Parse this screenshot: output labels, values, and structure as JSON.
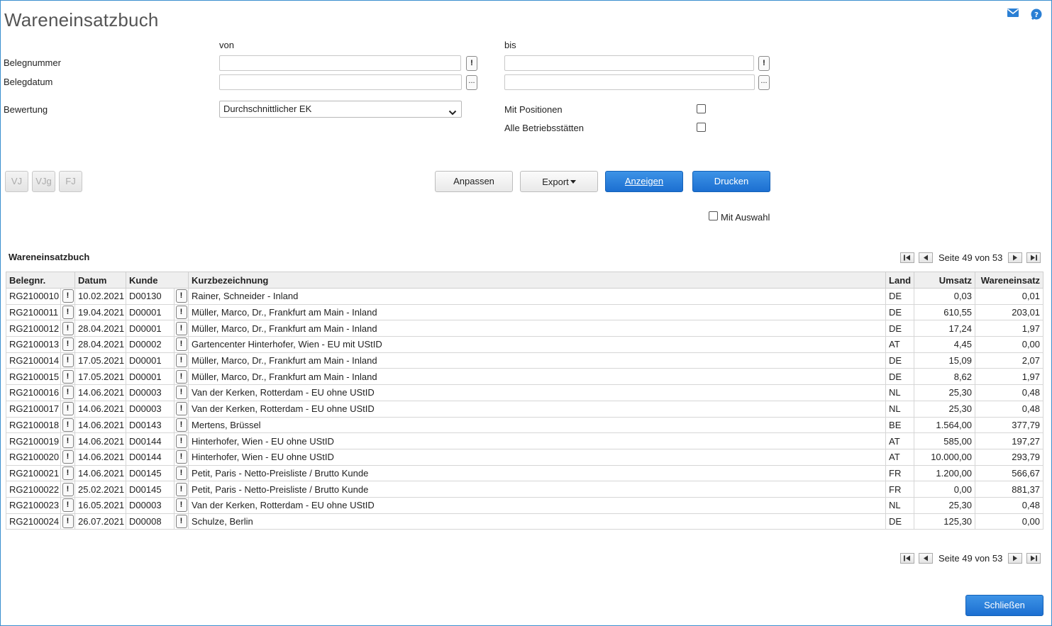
{
  "window": {
    "title": "Wareneinsatzbuch"
  },
  "icons": {
    "mail": "mail-icon",
    "help": "help-icon"
  },
  "filters": {
    "von_label": "von",
    "bis_label": "bis",
    "belegnummer_label": "Belegnummer",
    "belegdatum_label": "Belegdatum",
    "bewertung_label": "Bewertung",
    "belegnummer_von": "",
    "belegnummer_bis": "",
    "belegdatum_von": "",
    "belegdatum_bis": "",
    "bewertung_value": "Durchschnittlicher EK",
    "mit_positionen_label": "Mit Positionen",
    "mit_positionen_checked": false,
    "alle_betriebsstaetten_label": "Alle Betriebsstätten",
    "alle_betriebsstaetten_checked": false,
    "lookup_button": "!",
    "picker_button": "..."
  },
  "period_buttons": {
    "vj": "VJ",
    "vjg": "VJg",
    "fj": "FJ"
  },
  "actions": {
    "anpassen": "Anpassen",
    "export": "Export",
    "anzeigen": "Anzeigen",
    "drucken": "Drucken",
    "mit_auswahl_label": "Mit Auswahl",
    "mit_auswahl_checked": false
  },
  "result": {
    "title": "Wareneinsatzbuch",
    "pager_text": "Seite 49 von 53",
    "columns": [
      "Belegnr.",
      "Datum",
      "Kunde",
      "Kurzbezeichnung",
      "Land",
      "Umsatz",
      "Wareneinsatz"
    ],
    "rows": [
      [
        "RG2100010",
        "10.02.2021",
        "D00130",
        "Rainer, Schneider - Inland",
        "DE",
        "0,03",
        "0,01"
      ],
      [
        "RG2100011",
        "19.04.2021",
        "D00001",
        "Müller, Marco, Dr., Frankfurt am Main - Inland",
        "DE",
        "610,55",
        "203,01"
      ],
      [
        "RG2100012",
        "28.04.2021",
        "D00001",
        "Müller, Marco, Dr., Frankfurt am Main - Inland",
        "DE",
        "17,24",
        "1,97"
      ],
      [
        "RG2100013",
        "28.04.2021",
        "D00002",
        "Gartencenter Hinterhofer, Wien - EU mit UStID",
        "AT",
        "4,45",
        "0,00"
      ],
      [
        "RG2100014",
        "17.05.2021",
        "D00001",
        "Müller, Marco, Dr., Frankfurt am Main - Inland",
        "DE",
        "15,09",
        "2,07"
      ],
      [
        "RG2100015",
        "17.05.2021",
        "D00001",
        "Müller, Marco, Dr., Frankfurt am Main - Inland",
        "DE",
        "8,62",
        "1,97"
      ],
      [
        "RG2100016",
        "14.06.2021",
        "D00003",
        "Van der Kerken, Rotterdam - EU ohne UStID",
        "NL",
        "25,30",
        "0,48"
      ],
      [
        "RG2100017",
        "14.06.2021",
        "D00003",
        "Van der Kerken, Rotterdam - EU ohne UStID",
        "NL",
        "25,30",
        "0,48"
      ],
      [
        "RG2100018",
        "14.06.2021",
        "D00143",
        "Mertens, Brüssel",
        "BE",
        "1.564,00",
        "377,79"
      ],
      [
        "RG2100019",
        "14.06.2021",
        "D00144",
        "Hinterhofer, Wien - EU ohne UStID",
        "AT",
        "585,00",
        "197,27"
      ],
      [
        "RG2100020",
        "14.06.2021",
        "D00144",
        "Hinterhofer, Wien - EU ohne UStID",
        "AT",
        "10.000,00",
        "293,79"
      ],
      [
        "RG2100021",
        "14.06.2021",
        "D00145",
        "Petit, Paris - Netto-Preisliste / Brutto Kunde",
        "FR",
        "1.200,00",
        "566,67"
      ],
      [
        "RG2100022",
        "25.02.2021",
        "D00145",
        "Petit, Paris - Netto-Preisliste / Brutto Kunde",
        "FR",
        "0,00",
        "881,37"
      ],
      [
        "RG2100023",
        "16.05.2021",
        "D00003",
        "Van der Kerken, Rotterdam - EU ohne UStID",
        "NL",
        "25,30",
        "0,48"
      ],
      [
        "RG2100024",
        "26.07.2021",
        "D00008",
        "Schulze, Berlin",
        "DE",
        "125,30",
        "0,00"
      ]
    ]
  },
  "footer": {
    "close": "Schließen"
  },
  "colors": {
    "accent": "#1c6fd1",
    "border": "#3a8ecf"
  }
}
